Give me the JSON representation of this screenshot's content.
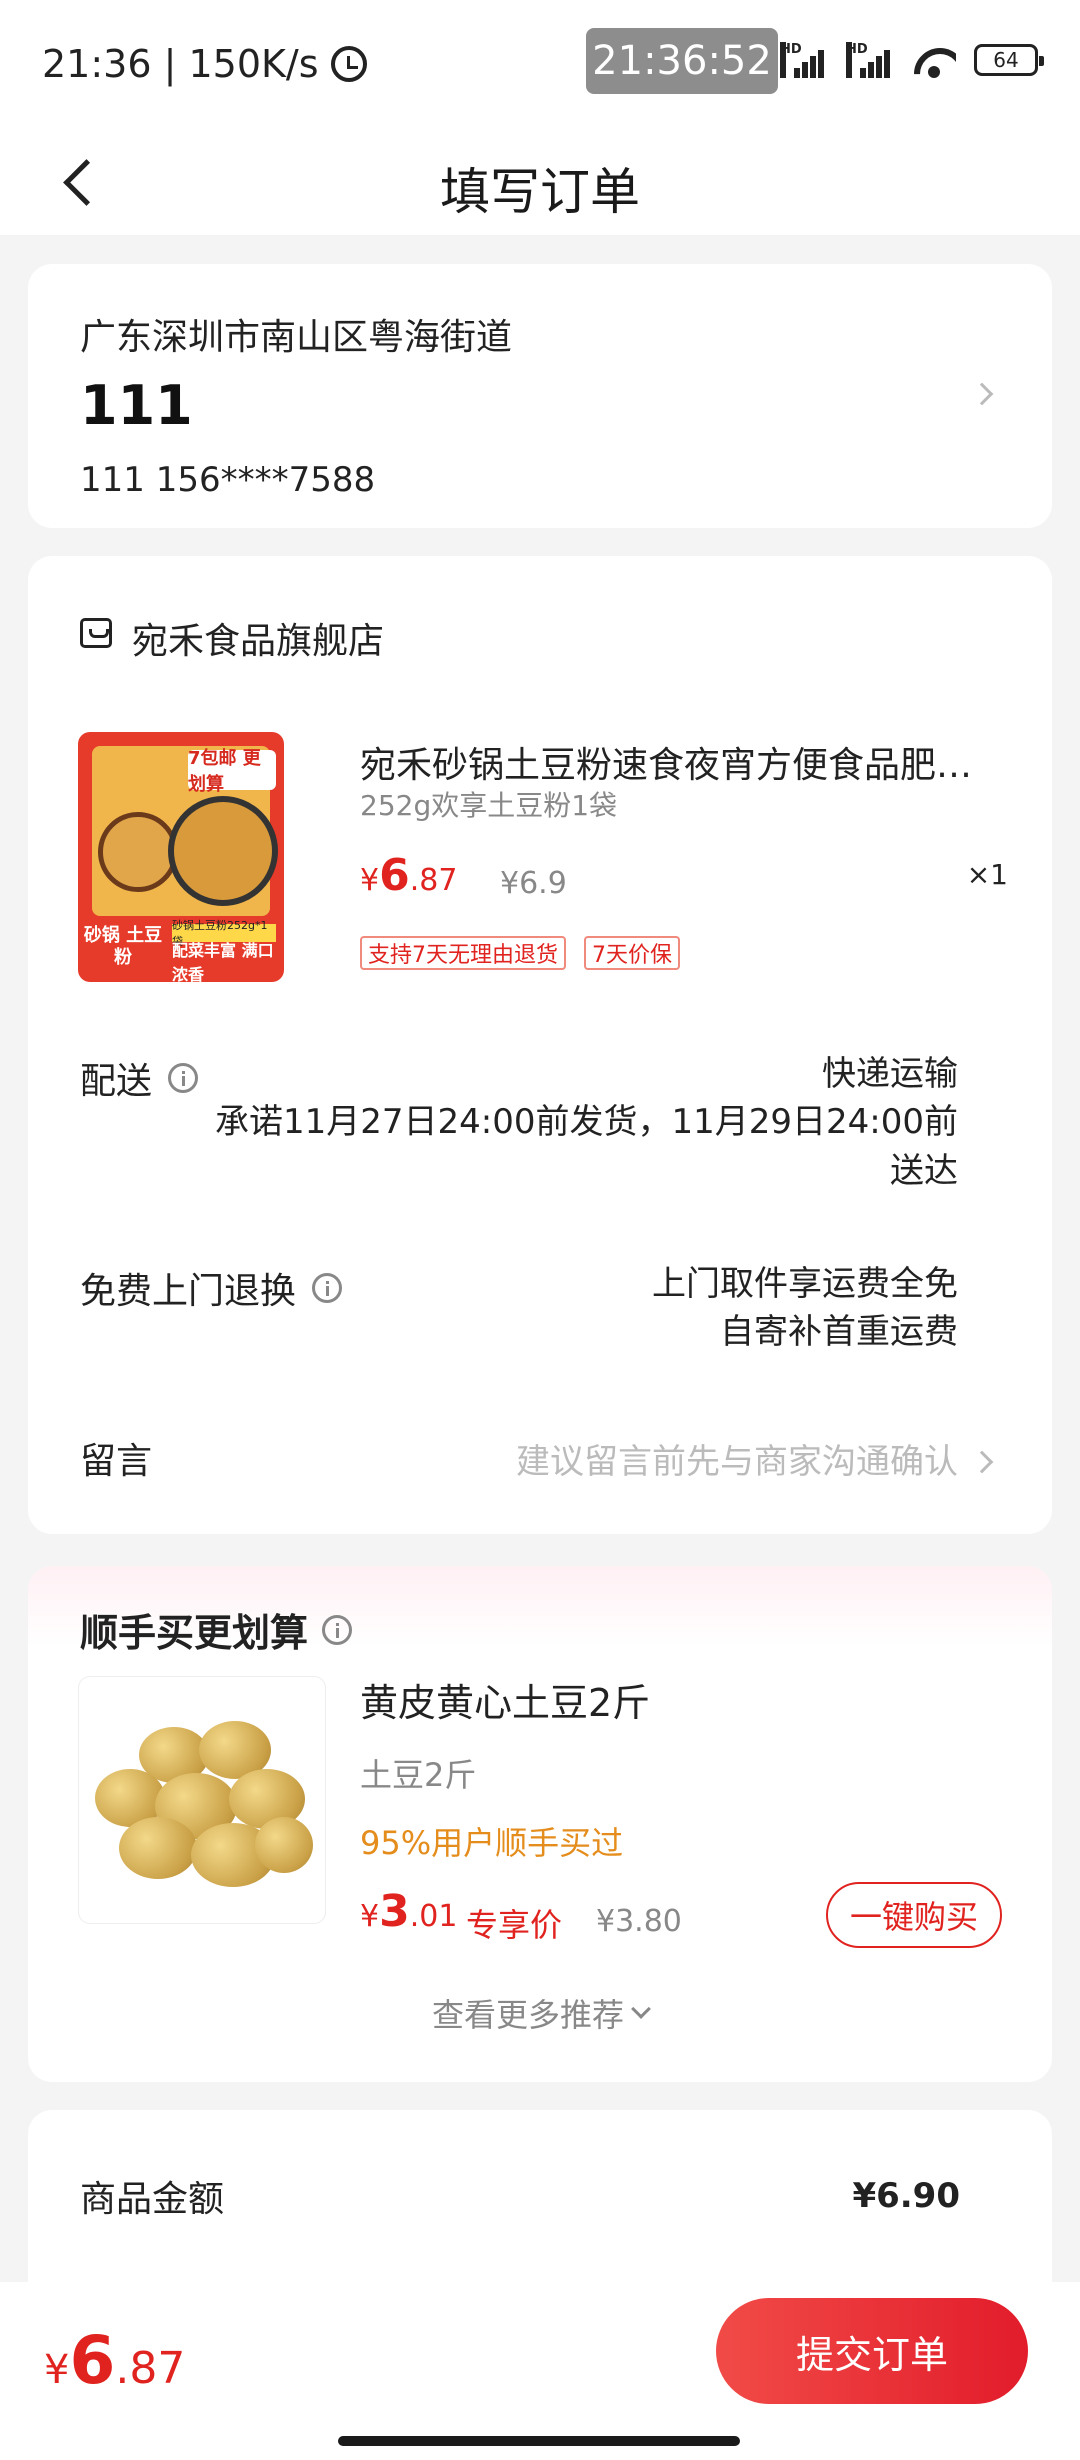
{
  "status_bar": {
    "time_speed": "21:36 | 150K/s",
    "clock_overlay": "21:36:52",
    "battery": "64"
  },
  "nav": {
    "title": "填写订单"
  },
  "address": {
    "region": "广东深圳市南山区粤海街道",
    "detail": "111",
    "contact": "111  156****7588"
  },
  "shop": {
    "name": "宛禾食品旗舰店",
    "product": {
      "title": "宛禾砂锅土豆粉速食夜宵方便食品肥…",
      "spec": "252g欢享土豆粉1袋",
      "price_symbol": "¥",
      "price_int": "6",
      "price_dec": ".87",
      "original_price": "¥6.9",
      "quantity": "×1",
      "tags": [
        "支持7天无理由退货",
        "7天价保"
      ],
      "image_text": {
        "badge": "7包邮 更划算",
        "strip": "砂锅土豆粉252g*1袋",
        "left": "砂锅 土豆粉",
        "right": "配菜丰富 满口浓香"
      }
    },
    "delivery": {
      "label": "配送",
      "method": "快递运输",
      "promise": "承诺11月27日24:00前发货，11月29日24:00前送达"
    },
    "returns": {
      "label": "免费上门退换",
      "line1": "上门取件享运费全免",
      "line2": "自寄补首重运费"
    },
    "remark": {
      "label": "留言",
      "hint": "建议留言前先与商家沟通确认"
    }
  },
  "recommend": {
    "title": "顺手买更划算",
    "item": {
      "name": "黄皮黄心土豆2斤",
      "spec": "土豆2斤",
      "popularity": "95%用户顺手买过",
      "price_symbol": "¥",
      "price_int": "3",
      "price_dec": ".01",
      "exclusive": "专享价",
      "original_price": "¥3.80",
      "buy_label": "一键购买"
    },
    "more_label": "查看更多推荐"
  },
  "summary": {
    "goods_amount_label": "商品金额",
    "goods_amount_value": "¥6.90"
  },
  "bottom": {
    "price_symbol": "¥",
    "price_int": "6",
    "price_dec": ".87",
    "submit_label": "提交订单"
  },
  "colors": {
    "accent": "#e0231f",
    "background": "#f4f4f4",
    "popularity": "#e48d1c"
  }
}
